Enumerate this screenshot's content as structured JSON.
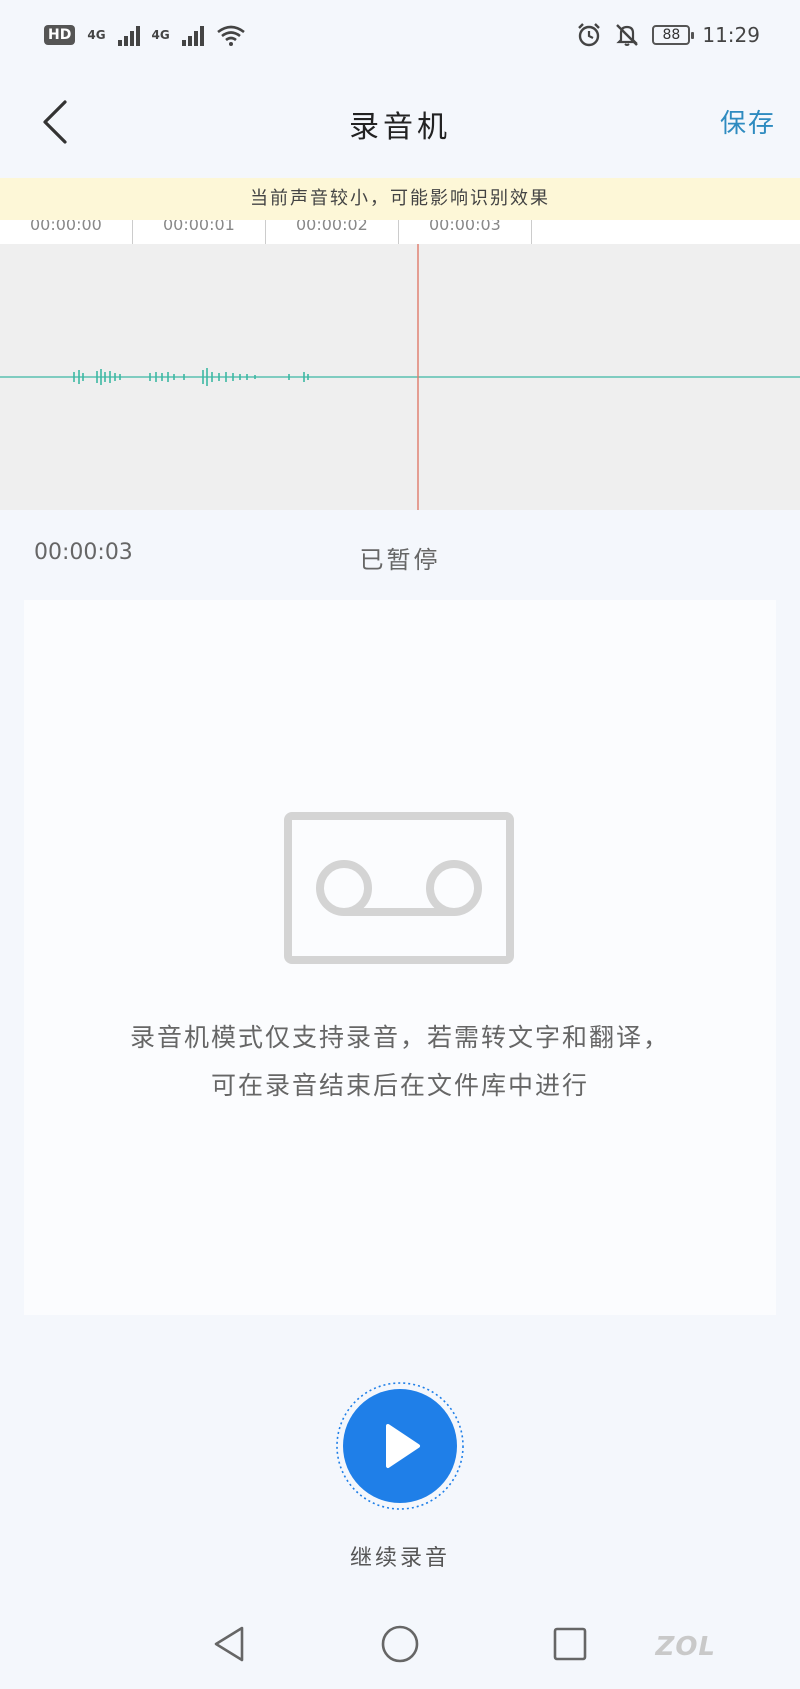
{
  "status_bar": {
    "hd_label": "HD",
    "network_1": "4G",
    "network_2": "4G",
    "battery": "88",
    "time": "11:29"
  },
  "header": {
    "title": "录音机",
    "save_label": "保存"
  },
  "banner": {
    "text": "当前声音较小，可能影响识别效果"
  },
  "timeline": {
    "ticks": [
      "00:00:00",
      "00:00:01",
      "00:00:02",
      "00:00:03"
    ]
  },
  "recording": {
    "elapsed": "00:00:03",
    "state": "已暂停"
  },
  "hint": {
    "line1": "录音机模式仅支持录音，若需转文字和翻译，",
    "line2": "可在录音结束后在文件库中进行"
  },
  "controls": {
    "continue_label": "继续录音"
  },
  "watermark": "ZOL",
  "colors": {
    "accent_blue": "#1f7fe8",
    "save_text": "#2e8bc0",
    "banner_bg": "#fdf7d7",
    "waveform": "#3cb8a3",
    "playhead": "#e07b6a"
  }
}
